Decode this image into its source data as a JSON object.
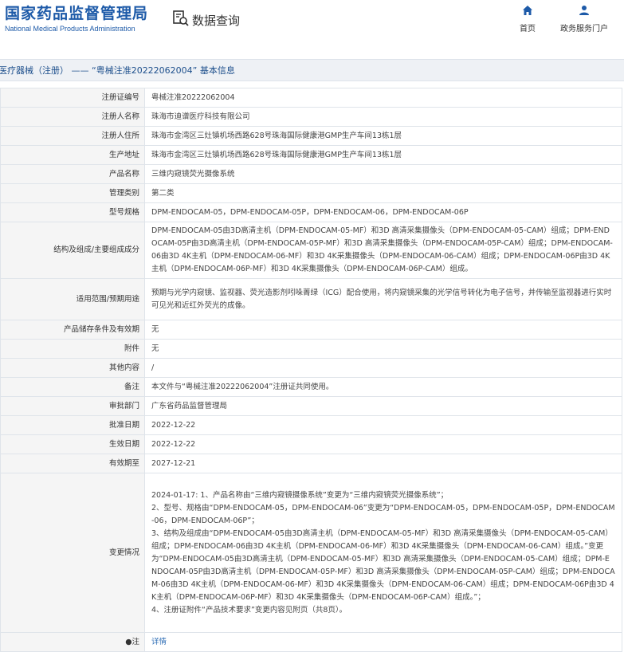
{
  "header": {
    "logo_cn": "国家药品监督管理局",
    "logo_en": "National Medical Products Administration",
    "query_label": "数据查询",
    "query_icon": "search-document-icon",
    "nav": [
      {
        "label": "首页",
        "icon": "home-icon"
      },
      {
        "label": "政务服务门户",
        "icon": "user-icon"
      }
    ],
    "brand_color": "#1d5aa8"
  },
  "breadcrumb": "医疗器械（注册） —— “粤械注准20222062004” 基本信息",
  "rows": [
    {
      "key": "注册证编号",
      "value": "粤械注准20222062004"
    },
    {
      "key": "注册人名称",
      "value": "珠海市迪谱医疗科技有限公司"
    },
    {
      "key": "注册人住所",
      "value": "珠海市金湾区三灶镇机场西路628号珠海国际健康港GMP生产车间13栋1层"
    },
    {
      "key": "生产地址",
      "value": "珠海市金湾区三灶镇机场西路628号珠海国际健康港GMP生产车间13栋1层"
    },
    {
      "key": "产品名称",
      "value": "三维内窥镜荧光摄像系统"
    },
    {
      "key": "管理类别",
      "value": "第二类"
    },
    {
      "key": "型号规格",
      "value": "DPM-ENDOCAM-05，DPM-ENDOCAM-05P，DPM-ENDOCAM-06，DPM-ENDOCAM-06P"
    },
    {
      "key": "结构及组成/主要组成成分",
      "value": "DPM-ENDOCAM-05由3D高清主机（DPM-ENDOCAM-05-MF）和3D 高清采集摄像头（DPM-ENDOCAM-05-CAM）组成；DPM-ENDOCAM-05P由3D高清主机（DPM-ENDOCAM-05P-MF）和3D 高清采集摄像头（DPM-ENDOCAM-05P-CAM）组成；DPM-ENDOCAM-06由3D 4K主机（DPM-ENDOCAM-06-MF）和3D 4K采集摄像头（DPM-ENDOCAM-06-CAM）组成；DPM-ENDOCAM-06P由3D 4K主机（DPM-ENDOCAM-06P-MF）和3D 4K采集摄像头（DPM-ENDOCAM-06P-CAM）组成。"
    },
    {
      "key": "适用范围/预期用途",
      "value": "预期与光学内窥镜、监视器、荧光造影剂吲哚菁绿（ICG）配合使用，将内窥镜采集的光学信号转化为电子信号，并传输至监视器进行实时可见光和近红外荧光的成像。"
    },
    {
      "key": "产品储存条件及有效期",
      "value": "无"
    },
    {
      "key": "附件",
      "value": "无"
    },
    {
      "key": "其他内容",
      "value": "/"
    },
    {
      "key": "备注",
      "value": "本文件与“粤械注准20222062004”注册证共同使用。"
    },
    {
      "key": "审批部门",
      "value": "广东省药品监督管理局"
    },
    {
      "key": "批准日期",
      "value": "2022-12-22"
    },
    {
      "key": "生效日期",
      "value": "2022-12-22"
    },
    {
      "key": "有效期至",
      "value": "2027-12-21"
    }
  ],
  "change": {
    "key": "变更情况",
    "lines": [
      "2024-01-17: 1、产品名称由“三维内窥镜摄像系统”变更为“三维内窥镜荧光摄像系统”；",
      "2、型号、规格由“DPM-ENDOCAM-05，DPM-ENDOCAM-06”变更为“DPM-ENDOCAM-05，DPM-ENDOCAM-05P，DPM-ENDOCAM-06，DPM-ENDOCAM-06P”；",
      "3、结构及组成由“DPM-ENDOCAM-05由3D高清主机（DPM-ENDOCAM-05-MF）和3D 高清采集摄像头（DPM-ENDOCAM-05-CAM）组成；DPM-ENDOCAM-06由3D 4K主机（DPM-ENDOCAM-06-MF）和3D 4K采集摄像头（DPM-ENDOCAM-06-CAM）组成。”变更为“DPM-ENDOCAM-05由3D高清主机（DPM-ENDOCAM-05-MF）和3D 高清采集摄像头（DPM-ENDOCAM-05-CAM）组成；DPM-ENDOCAM-05P由3D高清主机（DPM-ENDOCAM-05P-MF）和3D 高清采集摄像头（DPM-ENDOCAM-05P-CAM）组成；DPM-ENDOCAM-06由3D 4K主机（DPM-ENDOCAM-06-MF）和3D 4K采集摄像头（DPM-ENDOCAM-06-CAM）组成；DPM-ENDOCAM-06P由3D 4K主机（DPM-ENDOCAM-06P-MF）和3D 4K采集摄像头（DPM-ENDOCAM-06P-CAM）组成。”；",
      "4、注册证附件“产品技术要求”变更内容见附页（共8页）。"
    ]
  },
  "note": {
    "key": "●注",
    "link": "详情"
  }
}
